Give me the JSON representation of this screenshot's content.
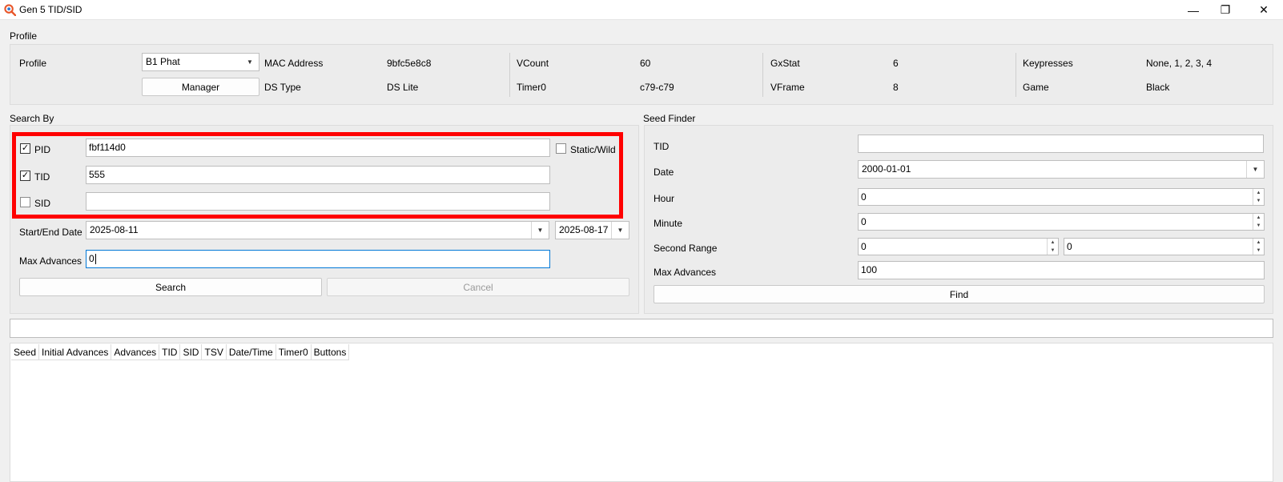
{
  "window": {
    "title": "Gen 5 TID/SID",
    "controls": {
      "minimize": "—",
      "restore": "❐",
      "close": "✕"
    }
  },
  "profile": {
    "group_label": "Profile",
    "profile_label": "Profile",
    "profile_value": "B1 Phat",
    "manager_button": "Manager",
    "fields": {
      "mac_label": "MAC Address",
      "mac_value": "9bfc5e8c8",
      "dstype_label": "DS Type",
      "dstype_value": "DS Lite",
      "vcount_label": "VCount",
      "vcount_value": "60",
      "timer0_label": "Timer0",
      "timer0_value": "c79-c79",
      "gxstat_label": "GxStat",
      "gxstat_value": "6",
      "vframe_label": "VFrame",
      "vframe_value": "8",
      "keypresses_label": "Keypresses",
      "keypresses_value": "None, 1, 2, 3, 4",
      "game_label": "Game",
      "game_value": "Black"
    }
  },
  "search_by": {
    "group_label": "Search By",
    "pid": {
      "label": "PID",
      "checked": true,
      "value": "fbf114d0"
    },
    "tid": {
      "label": "TID",
      "checked": true,
      "value": "555"
    },
    "sid": {
      "label": "SID",
      "checked": false,
      "value": ""
    },
    "static_wild": {
      "label": "Static/Wild",
      "checked": false
    },
    "date_label": "Start/End Date",
    "start_date": "2025-08-11",
    "end_date": "2025-08-17",
    "max_advances_label": "Max Advances",
    "max_advances_value": "0",
    "search_button": "Search",
    "cancel_button": "Cancel",
    "check_mark": "✓"
  },
  "seed_finder": {
    "group_label": "Seed Finder",
    "tid_label": "TID",
    "tid_value": "",
    "date_label": "Date",
    "date_value": "2000-01-01",
    "hour_label": "Hour",
    "hour_value": "0",
    "minute_label": "Minute",
    "minute_value": "0",
    "second_range_label": "Second Range",
    "second_start": "0",
    "second_end": "0",
    "max_advances_label": "Max Advances",
    "max_advances_value": "100",
    "find_button": "Find"
  },
  "results": {
    "columns": [
      "Seed",
      "Initial Advances",
      "Advances",
      "TID",
      "SID",
      "TSV",
      "Date/Time",
      "Timer0",
      "Buttons"
    ]
  },
  "icons": {
    "app": "magnifier-app-icon",
    "dropdown": "▼",
    "spin_up": "▲",
    "spin_down": "▼"
  },
  "colors": {
    "highlight": "#ff0000",
    "focus": "#0078d7",
    "app_icon": "#e8562a"
  }
}
